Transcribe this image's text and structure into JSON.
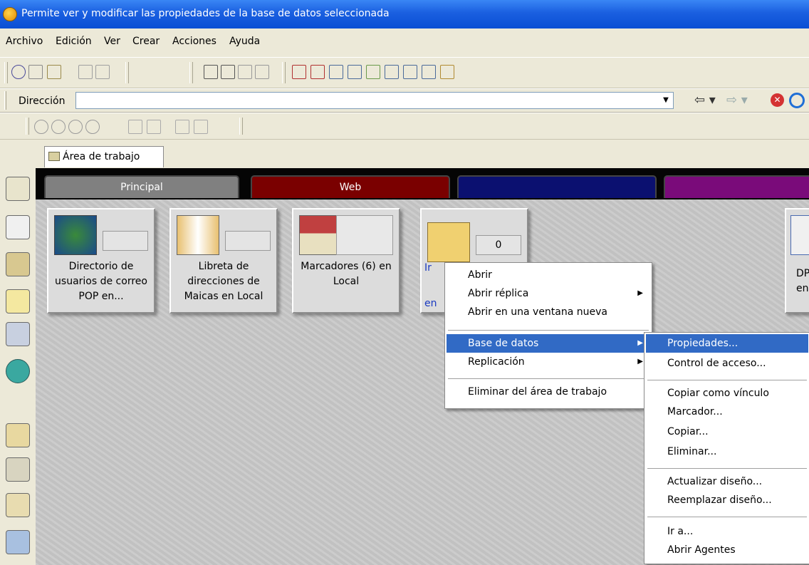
{
  "window": {
    "title": "Permite ver y modificar las propiedades de la base de datos seleccionada",
    "app_icon": "notes-app-icon"
  },
  "menubar": {
    "items": [
      "Archivo",
      "Edición",
      "Ver",
      "Crear",
      "Acciones",
      "Ayuda"
    ]
  },
  "addressbar": {
    "label": "Dirección",
    "value": ""
  },
  "workspace": {
    "tab_label": "Área de trabajo"
  },
  "category_tabs": [
    {
      "label": "Principal",
      "color": "#808080"
    },
    {
      "label": "Web",
      "color": "#7a0000"
    },
    {
      "label": "",
      "color": "#0b1070"
    },
    {
      "label": "",
      "color": "#7a0b7a"
    }
  ],
  "tiles": [
    {
      "label": "Directorio de usuarios de correo POP en...",
      "count": "",
      "icon": "globe-directory-icon"
    },
    {
      "label": "Libreta de direcciones de Maicas en Local",
      "count": "",
      "icon": "address-book-icon"
    },
    {
      "label": "Marcadores (6) en Local",
      "count": "",
      "icon": "bookmarks-house-icon"
    },
    {
      "label": "Ir",
      "label2": "en",
      "count": "0",
      "icon": "mail-envelope-icon"
    },
    {
      "label": "DP",
      "label2": "en",
      "count": "",
      "icon": "book-icon"
    }
  ],
  "context_menu": {
    "items": [
      {
        "label": "Abrir"
      },
      {
        "label": "Abrir réplica",
        "submenu": true
      },
      {
        "label": "Abrir en una ventana nueva"
      },
      {
        "label": "Base de datos",
        "submenu": true,
        "highlighted": true
      },
      {
        "label": "Replicación",
        "submenu": true
      },
      {
        "label": "Eliminar del área de trabajo"
      }
    ]
  },
  "submenu": {
    "items": [
      {
        "label": "Propiedades...",
        "highlighted": true
      },
      {
        "label": "Control de acceso..."
      },
      {
        "label": "Copiar como vínculo"
      },
      {
        "label": "Marcador..."
      },
      {
        "label": "Copiar..."
      },
      {
        "label": "Eliminar..."
      },
      {
        "label": "Actualizar diseño..."
      },
      {
        "label": "Reemplazar diseño..."
      },
      {
        "label": "Ir a..."
      },
      {
        "label": "Abrir Agentes"
      }
    ]
  },
  "colors": {
    "highlight": "#316ac5",
    "titlebar": "#0a4fd4"
  }
}
